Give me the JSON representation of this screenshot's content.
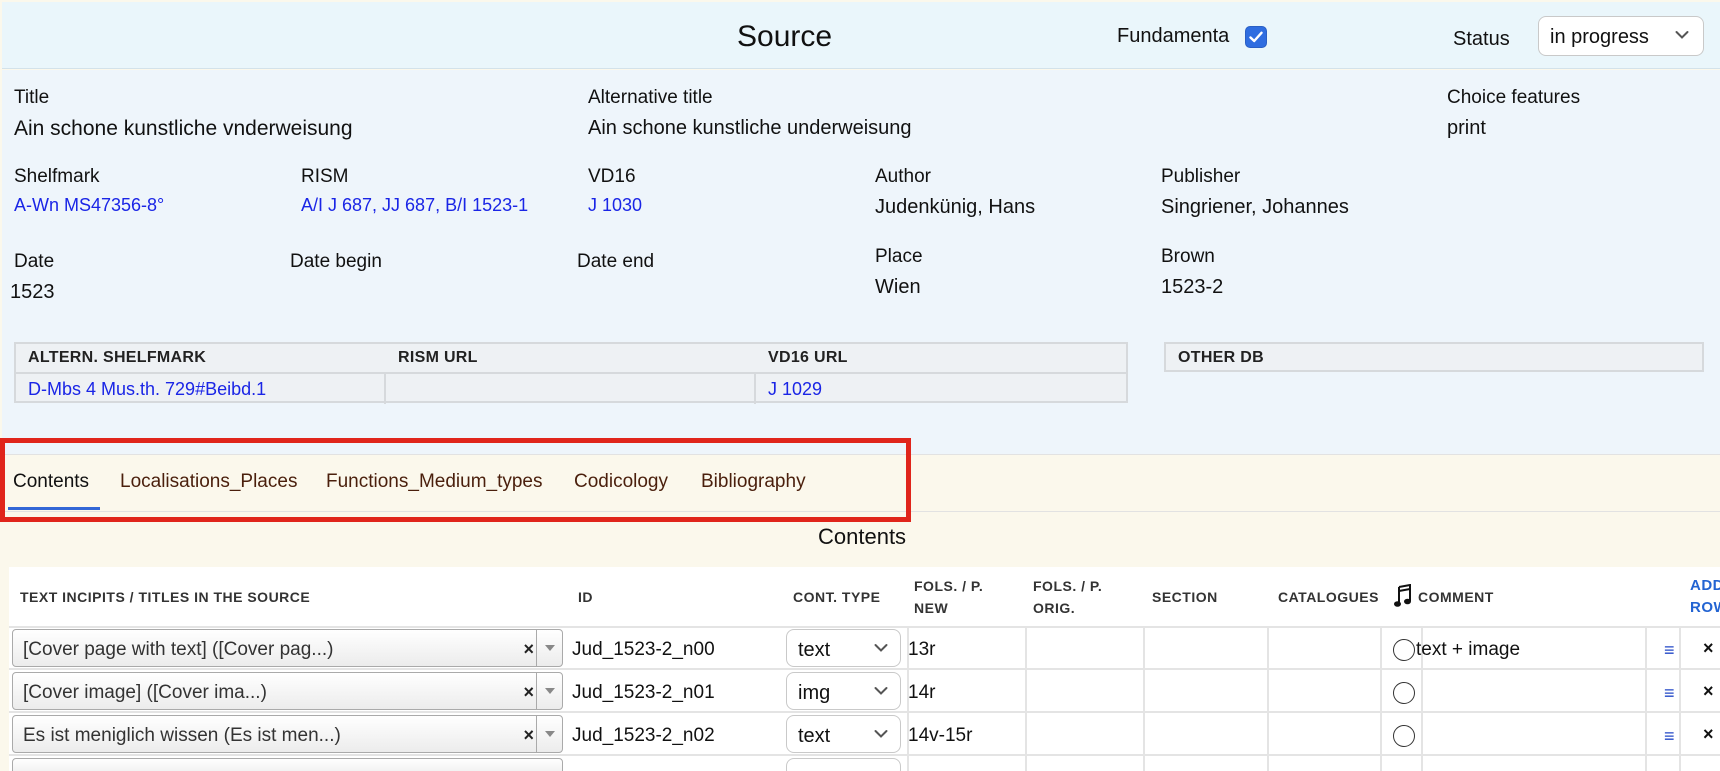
{
  "header": {
    "title": "Source",
    "fundamenta_label": "Fundamenta",
    "fundamenta_checked": true,
    "status_label": "Status",
    "status_value": "in progress"
  },
  "meta": {
    "title_label": "Title",
    "title_value": "Ain schone kunstliche vnderweisung",
    "alt_title_label": "Alternative title",
    "alt_title_value": "Ain schone kunstliche underweisung",
    "choice_label": "Choice features",
    "choice_value": "print",
    "shelfmark_label": "Shelfmark",
    "shelfmark_value": "A-Wn MS47356-8°",
    "rism_label": "RISM",
    "rism_value": "A/I J 687, JJ 687, B/I 1523-1",
    "vd16_label": "VD16",
    "vd16_value": "J 1030",
    "author_label": "Author",
    "author_value": "Judenkünig, Hans",
    "publisher_label": "Publisher",
    "publisher_value": "Singriener, Johannes",
    "date_label": "Date",
    "date_value": "1523",
    "date_begin_label": "Date begin",
    "date_end_label": "Date end",
    "place_label": "Place",
    "place_value": "Wien",
    "brown_label": "Brown",
    "brown_value": "1523-2"
  },
  "alt_table": {
    "headers": [
      "ALTERN. SHELFMARK",
      "RISM URL",
      "VD16 URL"
    ],
    "row": [
      "D-Mbs 4 Mus.th. 729#Beibd.1",
      "",
      "J 1029"
    ]
  },
  "other_db": {
    "header": "OTHER DB"
  },
  "tabs": [
    {
      "label": "Contents",
      "active": true
    },
    {
      "label": "Localisations_Places"
    },
    {
      "label": "Functions_Medium_types"
    },
    {
      "label": "Codicology"
    },
    {
      "label": "Bibliography"
    }
  ],
  "contents": {
    "title": "Contents",
    "columns": {
      "incipit": "TEXT INCIPITS / TITLES IN THE SOURCE",
      "id": "ID",
      "cont_type": "CONT. TYPE",
      "fols_new_1": "FOLS. / P.",
      "fols_new_2": "NEW",
      "fols_orig_1": "FOLS. / P.",
      "fols_orig_2": "ORIG.",
      "section": "SECTION",
      "catalogues": "CATALOGUES",
      "music_icon": "music-note-icon",
      "comment": "COMMENT",
      "add_row_1": "ADD",
      "add_row_2": "ROW"
    },
    "rows": [
      {
        "incipit": "[Cover page with text] ([Cover pag...)",
        "id": "Jud_1523-2_n00",
        "type": "text",
        "fols_new": "13r",
        "comment": "text + image"
      },
      {
        "incipit": "[Cover image] ([Cover ima...)",
        "id": "Jud_1523-2_n01",
        "type": "img",
        "fols_new": "14r",
        "comment": ""
      },
      {
        "incipit": "Es ist meniglich wissen (Es ist men...)",
        "id": "Jud_1523-2_n02",
        "type": "text",
        "fols_new": "14v-15r",
        "comment": ""
      }
    ]
  },
  "colors": {
    "header_bg": "#eaf6fb",
    "link": "#1a25e6",
    "highlight": "#e0251b",
    "accent": "#2f6de0"
  }
}
